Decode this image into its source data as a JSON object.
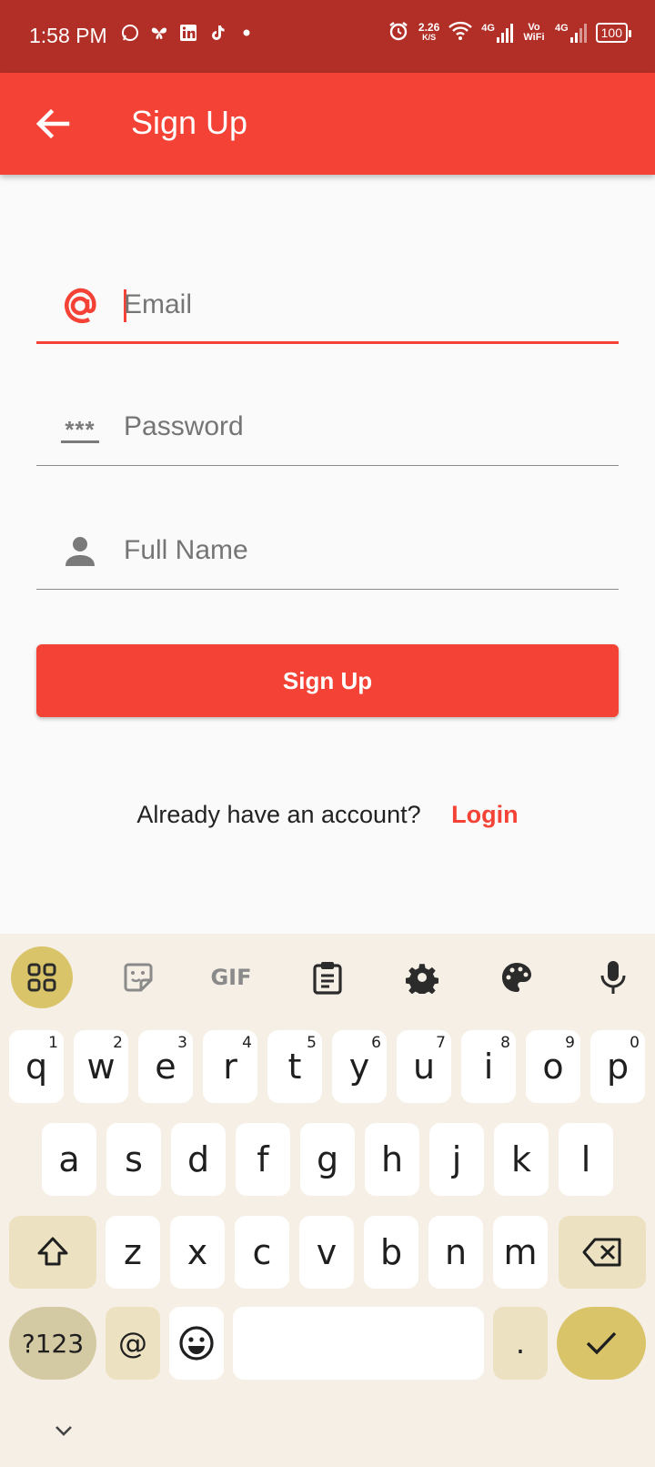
{
  "status_bar": {
    "time": "1:58 PM",
    "speed_value": "2.26",
    "speed_unit": "K/S",
    "net1": "4G",
    "volte": "Vo WiFi",
    "net2": "4G",
    "battery": "100",
    "app_icons": [
      "whatsapp-icon",
      "butterfly-icon",
      "linkedin-icon",
      "tiktok-icon",
      "dot-icon"
    ]
  },
  "app_bar": {
    "title": "Sign Up"
  },
  "form": {
    "email_placeholder": "Email",
    "password_placeholder": "Password",
    "password_icon_text": "***",
    "fullname_placeholder": "Full Name",
    "submit_label": "Sign Up"
  },
  "footer": {
    "question": "Already have an account?",
    "login_label": "Login"
  },
  "keyboard": {
    "toolbar": [
      "apps-grid-icon",
      "sticker-icon",
      "gif-icon",
      "clipboard-icon",
      "settings-icon",
      "palette-icon",
      "microphone-icon"
    ],
    "gif_label": "GIF",
    "row1": [
      {
        "k": "q",
        "h": "1"
      },
      {
        "k": "w",
        "h": "2"
      },
      {
        "k": "e",
        "h": "3"
      },
      {
        "k": "r",
        "h": "4"
      },
      {
        "k": "t",
        "h": "5"
      },
      {
        "k": "y",
        "h": "6"
      },
      {
        "k": "u",
        "h": "7"
      },
      {
        "k": "i",
        "h": "8"
      },
      {
        "k": "o",
        "h": "9"
      },
      {
        "k": "p",
        "h": "0"
      }
    ],
    "row2": [
      "a",
      "s",
      "d",
      "f",
      "g",
      "h",
      "j",
      "k",
      "l"
    ],
    "row3": [
      "z",
      "x",
      "c",
      "v",
      "b",
      "n",
      "m"
    ],
    "symbols_label": "?123",
    "at_label": "@",
    "period_label": ".",
    "colors": {
      "accent": "#d9c46a",
      "func": "#ece2c1",
      "background": "#f6efe6"
    }
  },
  "colors": {
    "primary": "#f44336",
    "status_bar": "#b22f27"
  }
}
